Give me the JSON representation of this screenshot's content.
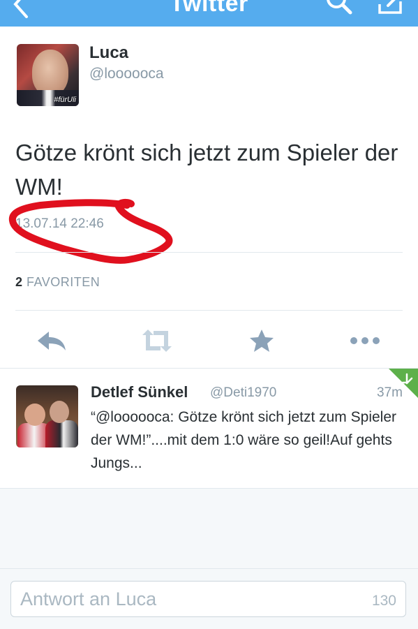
{
  "navbar": {
    "title": "Twitter",
    "background_color": "#55acee",
    "icons": [
      "back-arrow-icon",
      "search-icon",
      "compose-icon"
    ]
  },
  "tweet": {
    "name": "Luca",
    "handle": "@loooooca",
    "avatar_caption": "#fürUli",
    "text": "Götze krönt sich jetzt zum Spieler der WM!",
    "timestamp": "13.07.14 22:46",
    "favorites_count": "2",
    "favorites_label": "FAVORITEN",
    "actions": [
      "reply-icon",
      "retweet-icon",
      "favorite-star-icon",
      "more-icon"
    ]
  },
  "replies": [
    {
      "name": "Detlef Sünkel",
      "handle": "@Deti1970",
      "time": "37m",
      "text": "“@loooooca: Götze krönt sich jetzt zum Spieler der WM!”....mit dem 1:0 wäre so geil!Auf gehts Jungs..."
    }
  ],
  "composer": {
    "placeholder": "Antwort an Luca",
    "counter": "130"
  },
  "colors": {
    "accent_blue": "#55acee",
    "text_dark": "#292f33",
    "text_grey": "#8899a6",
    "icon_grey": "#8ba2b8",
    "scribble_red": "#e0101e",
    "retweet_corner_green": "#5db04a"
  }
}
